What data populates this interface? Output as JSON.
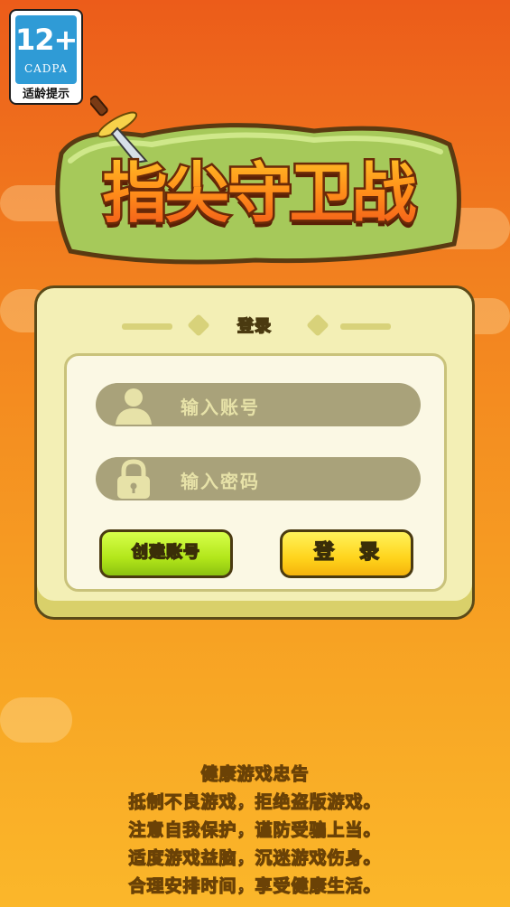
{
  "age_badge": {
    "age": "12+",
    "org": "CADPA",
    "tip": "适龄提示"
  },
  "logo": {
    "title": "指尖守卫战",
    "icon": "sword-icon"
  },
  "login_panel": {
    "title": "登录",
    "account_placeholder": "输入账号",
    "password_placeholder": "输入密码",
    "create_button": "创建账号",
    "login_button": "登录"
  },
  "health_notice": {
    "title": "健康游戏忠告",
    "lines": [
      "抵制不良游戏，拒绝盗版游戏。",
      "注意自我保护，谨防受骗上当。",
      "适度游戏益脑，沉迷游戏伤身。",
      "合理安排时间，享受健康生活。"
    ]
  },
  "colors": {
    "background_top": "#ec5c1a",
    "background_bottom": "#fbb72a",
    "panel": "#f3efb5",
    "create_button": "#b2e61a",
    "login_button": "#ffd41c",
    "badge_blue": "#2f9bd6"
  }
}
